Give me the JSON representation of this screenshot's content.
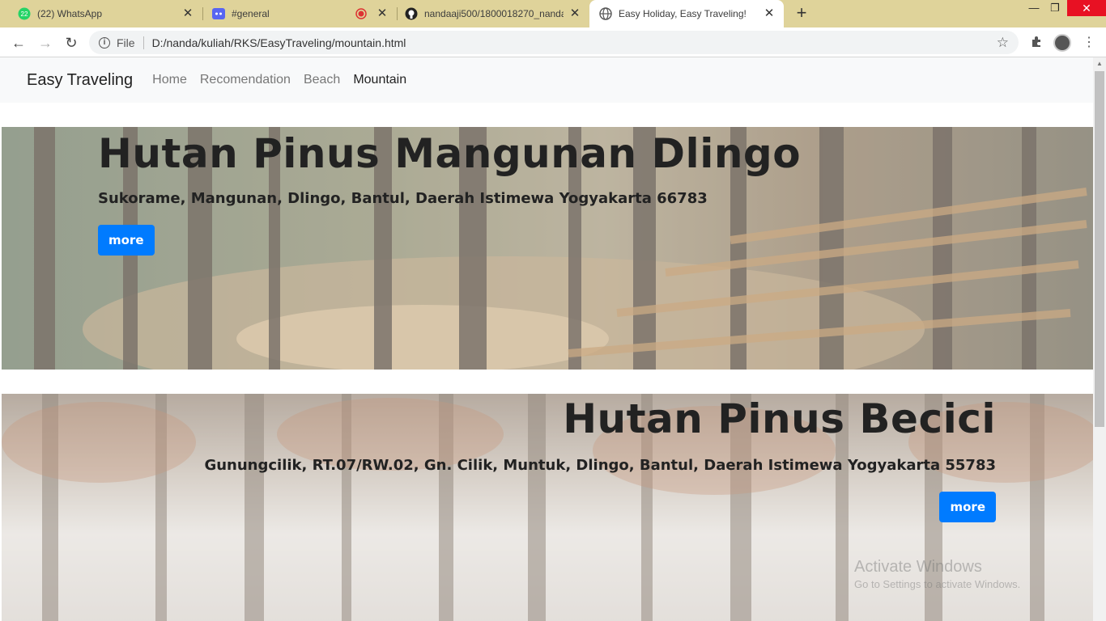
{
  "browser": {
    "tabs": [
      {
        "title": "(22) WhatsApp",
        "badge": "22",
        "icon": "whatsapp-icon"
      },
      {
        "title": "#general",
        "icon": "discord-icon"
      },
      {
        "title": "nandaaji500/1800018270_nanda",
        "icon": "github-icon"
      },
      {
        "title": "Easy Holiday, Easy Traveling!",
        "icon": "globe-icon"
      }
    ],
    "address": {
      "scheme_label": "File",
      "url": "D:/nanda/kuliah/RKS/EasyTraveling/mountain.html"
    }
  },
  "page": {
    "navbar": {
      "brand": "Easy Traveling",
      "links": [
        "Home",
        "Recomendation",
        "Beach",
        "Mountain"
      ],
      "active": "Mountain"
    },
    "heroes": [
      {
        "title": "Hutan Pinus Mangunan Dlingo",
        "address": "Sukorame, Mangunan, Dlingo, Bantul, Daerah Istimewa Yogyakarta 66783",
        "button": "more"
      },
      {
        "title": "Hutan Pinus Becici",
        "address": "Gunungcilik, RT.07/RW.02, Gn. Cilik, Muntuk, Dlingo, Bantul, Daerah Istimewa Yogyakarta 55783",
        "button": "more"
      }
    ]
  },
  "watermark": {
    "line1": "Activate Windows",
    "line2": "Go to Settings to activate Windows."
  },
  "colors": {
    "tabstrip": "#dfd39a",
    "primary": "#007bff",
    "navbar_bg": "#f8f9fa"
  }
}
